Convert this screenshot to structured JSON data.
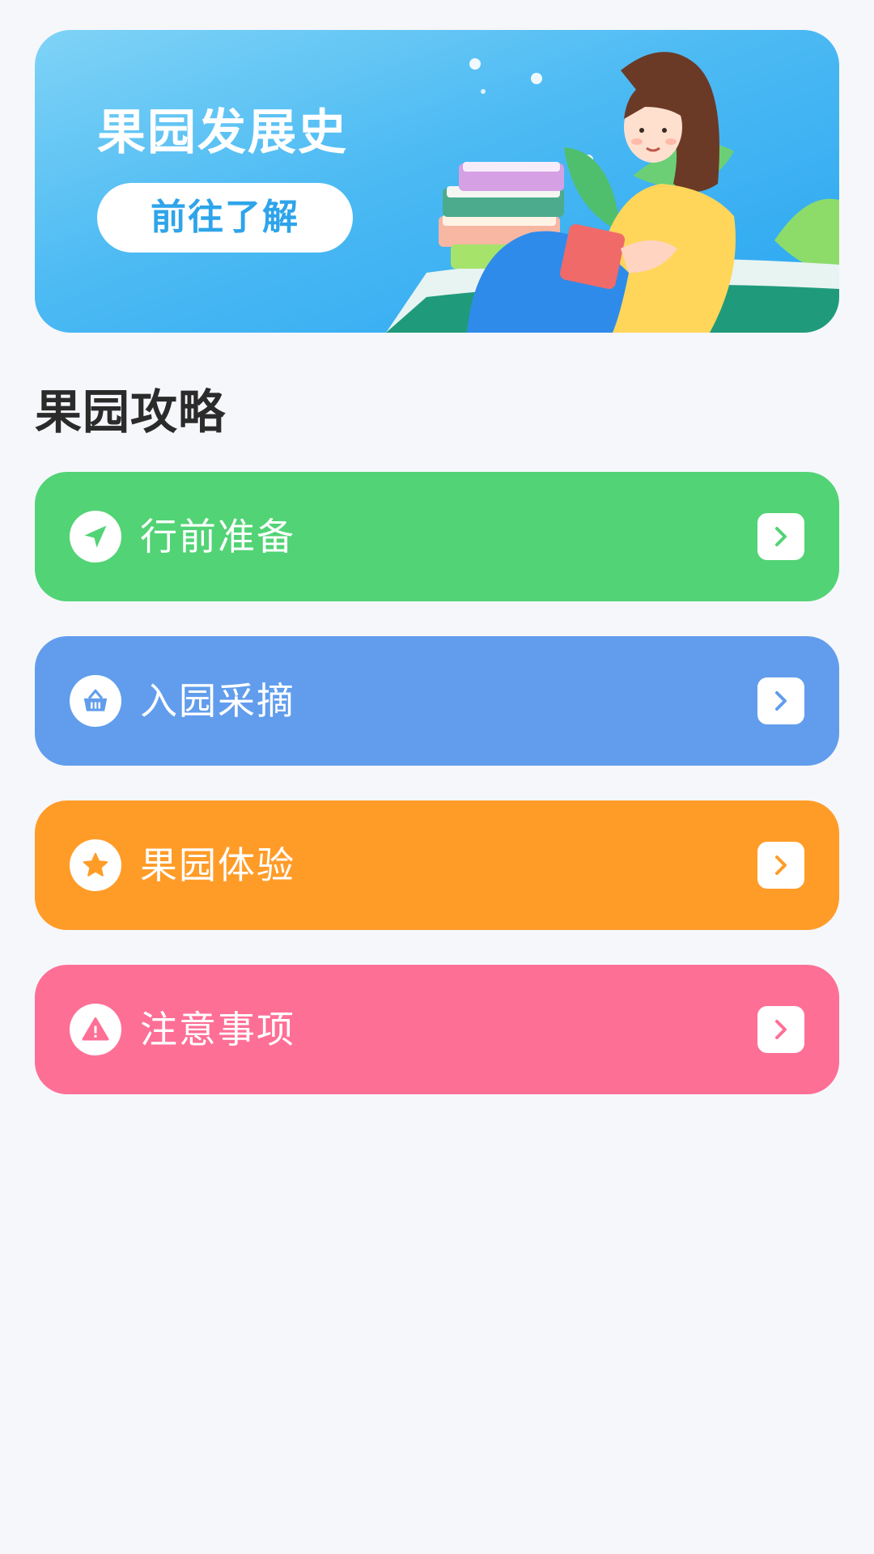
{
  "banner": {
    "title": "果园发展史",
    "button_label": "前往了解"
  },
  "section_title": "果园攻略",
  "cards": [
    {
      "label": "行前准备",
      "icon": "navigation-icon",
      "color": "#52d375"
    },
    {
      "label": "入园采摘",
      "icon": "basket-icon",
      "color": "#619dec"
    },
    {
      "label": "果园体验",
      "icon": "star-icon",
      "color": "#ff9c28"
    },
    {
      "label": "注意事项",
      "icon": "warning-icon",
      "color": "#fe6f96"
    }
  ]
}
